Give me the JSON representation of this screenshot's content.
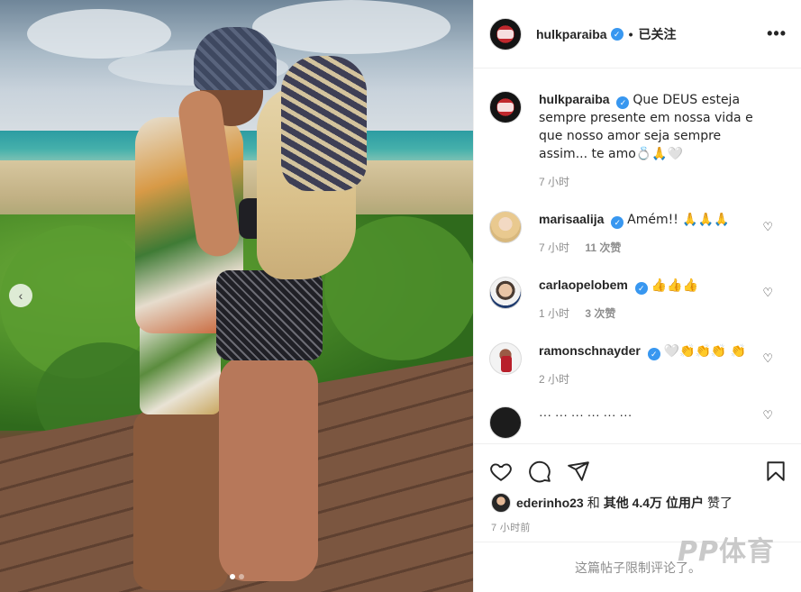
{
  "post": {
    "author": "hulkparaiba",
    "separator": "•",
    "follow_status": "已关注",
    "more_label": "•••"
  },
  "caption": {
    "username": "hulkparaiba",
    "text": "Que DEUS esteja sempre presente em nossa vida e que nosso amor seja sempre assim... te amo💍🙏🤍",
    "time": "7 小时"
  },
  "comments": [
    {
      "username": "marisaalija",
      "text": "Amém!! 🙏🙏🙏",
      "time": "7 小时",
      "likes": "11 次赞"
    },
    {
      "username": "carlaopelobem",
      "text": "👍👍👍",
      "time": "1 小时",
      "likes": "3 次赞"
    },
    {
      "username": "ramonschnayder",
      "text": "🤍👏👏👏 👏",
      "time": "2 小时",
      "likes": ""
    }
  ],
  "partial_comment": {
    "text": "··· ··· ··· ··· ··· ···"
  },
  "icons": {
    "like": "heart-icon",
    "comment": "comment-icon",
    "share": "direct-share-icon",
    "save": "bookmark-icon",
    "carousel_prev": "‹"
  },
  "likes_line": {
    "user": "ederinho23",
    "and": "和",
    "others": "其他 4.4万 位用户",
    "suffix": "赞了"
  },
  "post_time": "7 小时前",
  "comments_limited": "这篇帖子限制评论了。",
  "watermark": {
    "logo": "PP",
    "text": "体育"
  },
  "colors": {
    "verified": "#3897f0",
    "muted": "#8e8e8e",
    "text": "#262626"
  },
  "carousel": {
    "count": 2,
    "active": 0
  }
}
